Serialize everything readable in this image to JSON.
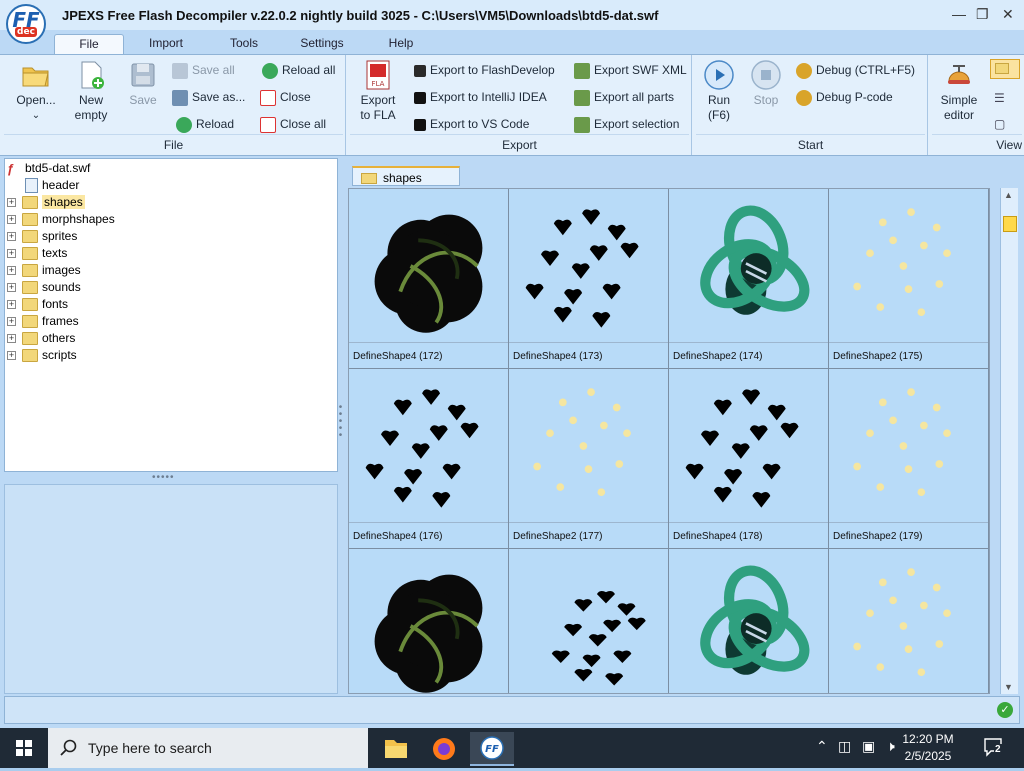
{
  "window": {
    "title": "JPEXS Free Flash Decompiler v.22.0.2 nightly build 3025 - C:\\Users\\VM5\\Downloads\\btd5-dat.swf",
    "logo": {
      "main": "FF",
      "sub": "dec"
    },
    "controls": [
      "minimize-icon",
      "restore-icon",
      "close-icon"
    ]
  },
  "menu_tabs": [
    "File",
    "Import",
    "Tools",
    "Settings",
    "Help"
  ],
  "active_menu_tab": "File",
  "ribbon": {
    "file": {
      "name": "File",
      "open": "Open...",
      "new_empty": "New\nempty",
      "save": "Save",
      "save_all": "Save all",
      "save_as": "Save as...",
      "reload": "Reload",
      "reload_all": "Reload all",
      "close": "Close",
      "close_all": "Close all"
    },
    "export": {
      "name": "Export",
      "export_fla_l1": "Export",
      "export_fla_l2": "to FLA",
      "to_flashdevelop": "Export to FlashDevelop",
      "to_intellij": "Export to IntelliJ IDEA",
      "to_vscode": "Export to VS Code",
      "swf_xml": "Export SWF XML",
      "all_parts": "Export all parts",
      "selection": "Export selection"
    },
    "start": {
      "name": "Start",
      "run_l1": "Run",
      "run_l2": "(F6)",
      "stop": "Stop",
      "debug": "Debug (CTRL+F5)",
      "debug_pcode": "Debug P-code"
    },
    "view": {
      "name": "View",
      "simple_l1": "Simple",
      "simple_l2": "editor"
    }
  },
  "tree": {
    "root": "btd5-dat.swf",
    "items": [
      {
        "label": "header",
        "expandable": false
      },
      {
        "label": "shapes",
        "expandable": true,
        "selected": true
      },
      {
        "label": "morphshapes",
        "expandable": true
      },
      {
        "label": "sprites",
        "expandable": true
      },
      {
        "label": "texts",
        "expandable": true
      },
      {
        "label": "images",
        "expandable": true
      },
      {
        "label": "sounds",
        "expandable": true
      },
      {
        "label": "fonts",
        "expandable": true
      },
      {
        "label": "frames",
        "expandable": true
      },
      {
        "label": "others",
        "expandable": true
      },
      {
        "label": "scripts",
        "expandable": true
      }
    ]
  },
  "main_tab": "shapes",
  "shapes": [
    {
      "caption": "DefineShape4 (172)",
      "kind": "blob-dark"
    },
    {
      "caption": "DefineShape4 (173)",
      "kind": "hearts"
    },
    {
      "caption": "DefineShape2 (174)",
      "kind": "knot-teal"
    },
    {
      "caption": "DefineShape2 (175)",
      "kind": "dots"
    },
    {
      "caption": "DefineShape4 (176)",
      "kind": "hearts"
    },
    {
      "caption": "DefineShape2 (177)",
      "kind": "dots"
    },
    {
      "caption": "DefineShape4 (178)",
      "kind": "hearts"
    },
    {
      "caption": "DefineShape2 (179)",
      "kind": "dots"
    },
    {
      "caption": "",
      "kind": "blob-dark"
    },
    {
      "caption": "",
      "kind": "hearts-small"
    },
    {
      "caption": "",
      "kind": "knot-teal"
    },
    {
      "caption": "",
      "kind": "dots"
    }
  ],
  "taskbar": {
    "search_placeholder": "Type here to search",
    "time": "12:20 PM",
    "date": "2/5/2025",
    "notification_count": "2"
  },
  "colors": {
    "accent": "#1d5fb0",
    "selected_tree": "#fbe7a2",
    "panel_bg": "#b8dbf8"
  }
}
